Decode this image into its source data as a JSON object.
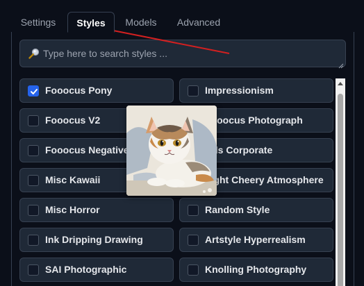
{
  "tabs": [
    {
      "label": "Settings",
      "active": false
    },
    {
      "label": "Styles",
      "active": true
    },
    {
      "label": "Models",
      "active": false
    },
    {
      "label": "Advanced",
      "active": false
    }
  ],
  "search": {
    "placeholder": "Type here to search styles ...",
    "value": ""
  },
  "styles_left": [
    {
      "label": "Fooocus Pony",
      "checked": true
    },
    {
      "label": "Fooocus V2",
      "checked": false
    },
    {
      "label": "Fooocus Negative",
      "checked": false
    },
    {
      "label": "Misc Kawaii",
      "checked": false
    },
    {
      "label": "Misc Horror",
      "checked": false
    },
    {
      "label": "Ink Dripping Drawing",
      "checked": false
    },
    {
      "label": "SAI Photographic",
      "checked": false
    }
  ],
  "styles_right": [
    {
      "label": "Impressionism",
      "checked": false
    },
    {
      "label": "Fooocus Photograph",
      "checked": false
    },
    {
      "label": "Ads Corporate",
      "checked": false
    },
    {
      "label": "Light Cheery Atmosphere",
      "checked": false
    },
    {
      "label": "Random Style",
      "checked": false
    },
    {
      "label": "Artstyle Hyperrealism",
      "checked": false
    },
    {
      "label": "Knolling Photography",
      "checked": false
    }
  ],
  "preview": {
    "icon": "cat-style-preview-image"
  },
  "colors": {
    "background": "#0b0f19",
    "item_bg": "#1f2937",
    "border": "#374151",
    "checkbox_accent": "#2563eb",
    "annotation_arrow": "#d32020"
  }
}
